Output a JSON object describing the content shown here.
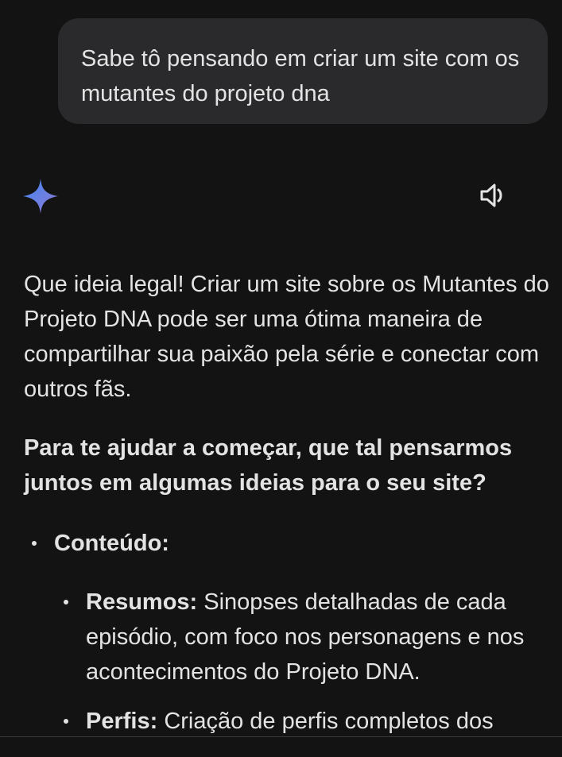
{
  "user_message": {
    "text": "Sabe tô pensando em criar um site com os mutantes do projeto dna"
  },
  "assistant": {
    "icon": "gemini-spark-icon",
    "speaker_icon": "speaker-icon",
    "paragraph1": "Que ideia legal! Criar um site sobre os Mutantes do Projeto DNA pode ser uma ótima maneira de compartilhar sua paixão pela série e conectar com outros fãs.",
    "paragraph2": "Para te ajudar a começar, que tal pensarmos juntos em algumas ideias para o seu site?",
    "bullets": [
      {
        "label": "Conteúdo:",
        "sub": [
          {
            "title": "Resumos:",
            "text": " Sinopses detalhadas de cada episódio, com foco nos personagens e nos acontecimentos do Projeto DNA."
          },
          {
            "title": "Perfis:",
            "text": " Criação de perfis completos dos"
          }
        ]
      }
    ]
  },
  "colors": {
    "background": "#131314",
    "bubble": "#2a2a2c",
    "text": "#e3e3e3",
    "spark_blue": "#4285f4",
    "spark_purple": "#9b72cb"
  }
}
